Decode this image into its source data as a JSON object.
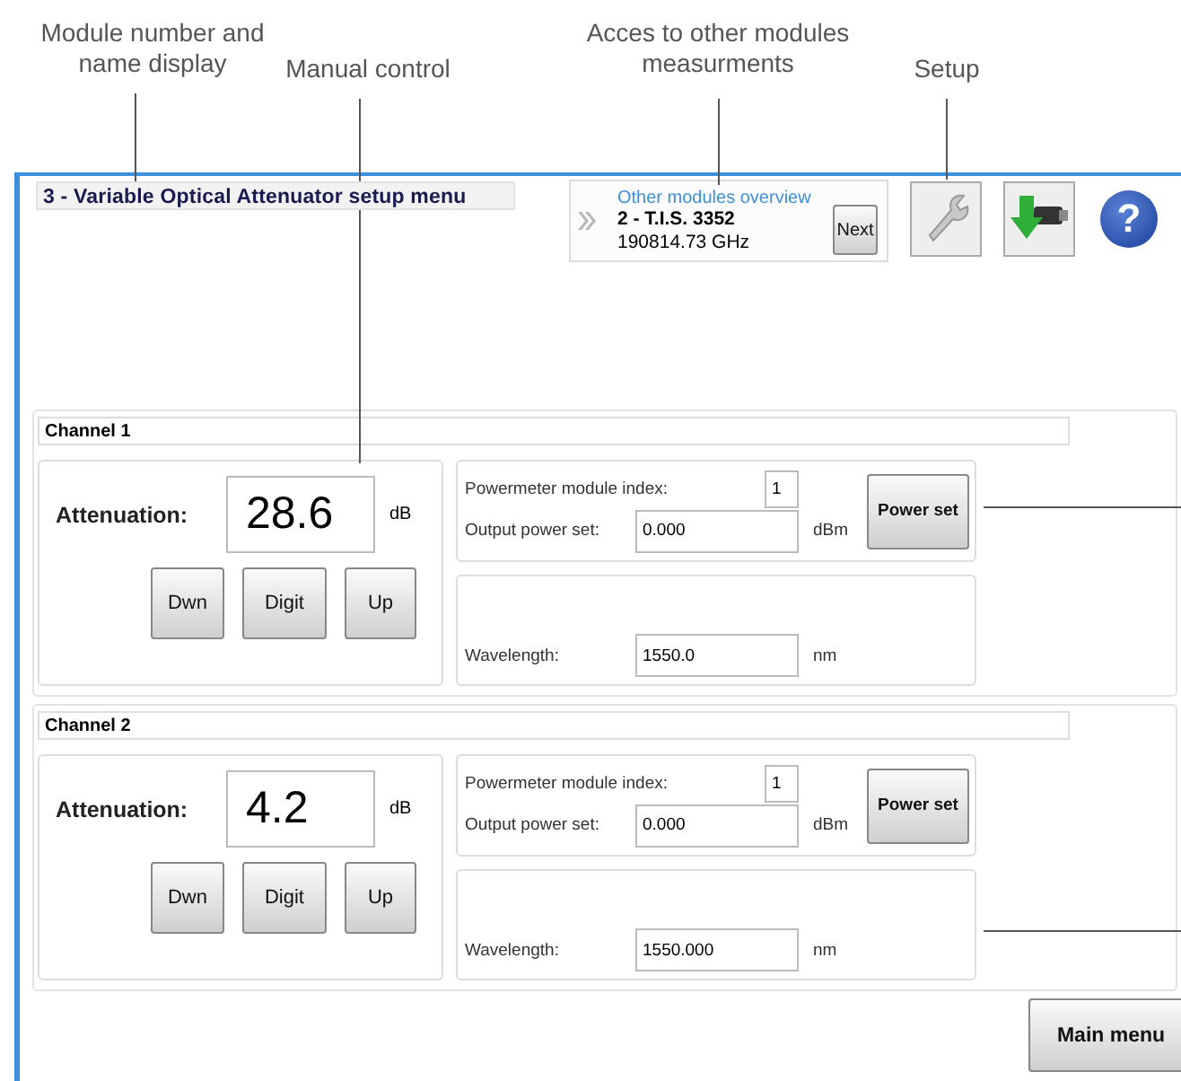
{
  "annotations": [
    {
      "text": "Module number and name display"
    },
    {
      "text": "Manual control"
    },
    {
      "text": "Acces to other modules measurments"
    },
    {
      "text": "Setup"
    }
  ],
  "window": {
    "title": "3 - Variable Optical Attenuator setup menu",
    "overview": {
      "caption": "Other modules overview",
      "module": "2 - T.I.S. 3352",
      "frequency": "190814.73 GHz",
      "next_button": "Next"
    },
    "help_button": "?",
    "channels": [
      {
        "header": "Channel 1",
        "attenuation_label": "Attenuation:",
        "attenuation": "28.6",
        "attenuation_unit": "dB",
        "buttons": [
          "Dwn",
          "Digit",
          "Up"
        ],
        "index_label": "Powermeter module index:",
        "index": "1",
        "output_label": "Output power set:",
        "output": "0.000",
        "output_unit": "dBm",
        "power_button": "Power set",
        "wavelength_label": "Wavelength:",
        "wavelength": "1550.0",
        "wavelength_unit": "nm"
      },
      {
        "header": "Channel 2",
        "attenuation_label": "Attenuation:",
        "attenuation": "4.2",
        "attenuation_unit": "dB",
        "buttons": [
          "Dwn",
          "Digit",
          "Up"
        ],
        "index_label": "Powermeter module index:",
        "index": "1",
        "output_label": "Output power set:",
        "output": "0.000",
        "output_unit": "dBm",
        "power_button": "Power set",
        "wavelength_label": "Wavelength:",
        "wavelength": "1550.000",
        "wavelength_unit": "nm"
      }
    ],
    "main_menu_button": "Main menu"
  }
}
